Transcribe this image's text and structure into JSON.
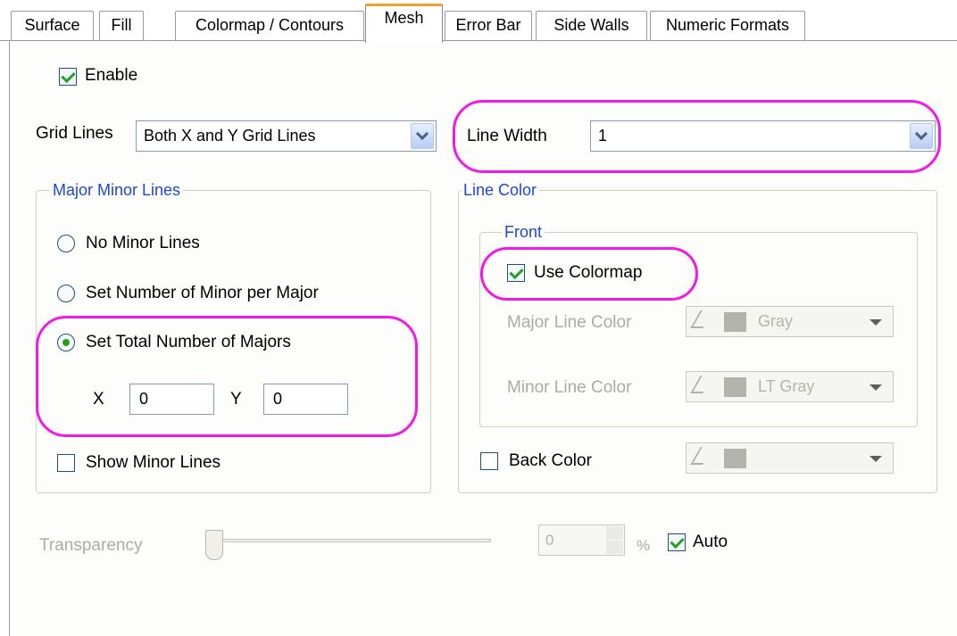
{
  "tabs": [
    {
      "label": "Surface",
      "active": false
    },
    {
      "label": "Fill",
      "active": false
    },
    {
      "label": "Colormap / Contours",
      "active": false
    },
    {
      "label": "Mesh",
      "active": true
    },
    {
      "label": "Error Bar",
      "active": false
    },
    {
      "label": "Side Walls",
      "active": false
    },
    {
      "label": "Numeric Formats",
      "active": false
    }
  ],
  "enable": {
    "label": "Enable",
    "checked": true
  },
  "grid_lines": {
    "label": "Grid Lines",
    "value": "Both X and Y Grid Lines"
  },
  "line_width": {
    "label": "Line Width",
    "value": "1"
  },
  "major_minor": {
    "title": "Major Minor Lines",
    "options": [
      {
        "label": "No Minor Lines",
        "selected": false
      },
      {
        "label": "Set Number of Minor per Major",
        "selected": false
      },
      {
        "label": "Set Total Number of Majors",
        "selected": true
      }
    ],
    "x_label": "X",
    "x_value": "0",
    "y_label": "Y",
    "y_value": "0",
    "show_minor": {
      "label": "Show Minor Lines",
      "checked": false
    }
  },
  "line_color": {
    "title": "Line Color",
    "front": {
      "title": "Front",
      "use_colormap": {
        "label": "Use Colormap",
        "checked": true
      },
      "major_label": "Major Line Color",
      "major_value": "Gray",
      "minor_label": "Minor Line Color",
      "minor_value": "LT Gray"
    },
    "back": {
      "label": "Back Color",
      "checked": false
    }
  },
  "transparency": {
    "label": "Transparency",
    "value": "0",
    "unit": "%",
    "level_percent": 0
  },
  "auto": {
    "label": "Auto",
    "checked": true
  },
  "colors": {
    "highlight": "#f21ae4",
    "group_title": "#1f47d6",
    "check": "#21a121",
    "tab_accent": "#f0a030"
  }
}
